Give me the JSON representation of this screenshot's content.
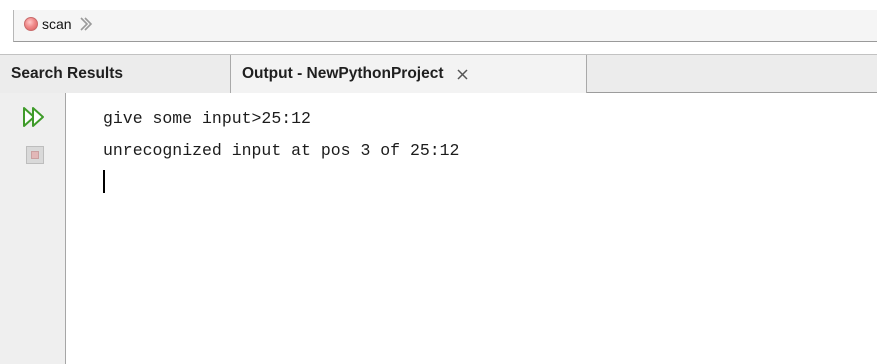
{
  "breadcrumb": {
    "item_label": "scan",
    "status_icon": "stop-dot-icon",
    "separator_icon": "chevron-right-icon"
  },
  "tabs": [
    {
      "label": "Search Results",
      "active": false
    },
    {
      "label": "Output - NewPythonProject",
      "active": true,
      "closable": true
    }
  ],
  "toolbar": {
    "rerun_icon": "rerun-icon",
    "stop_icon": "stop-icon"
  },
  "console": {
    "lines": [
      "give some input>25:12",
      "unrecognized input at pos 3 of 25:12"
    ]
  },
  "colors": {
    "rerun_icon": "#3f9b2a",
    "stop_dot": "#e87474",
    "tab_bar": "#ececec"
  }
}
